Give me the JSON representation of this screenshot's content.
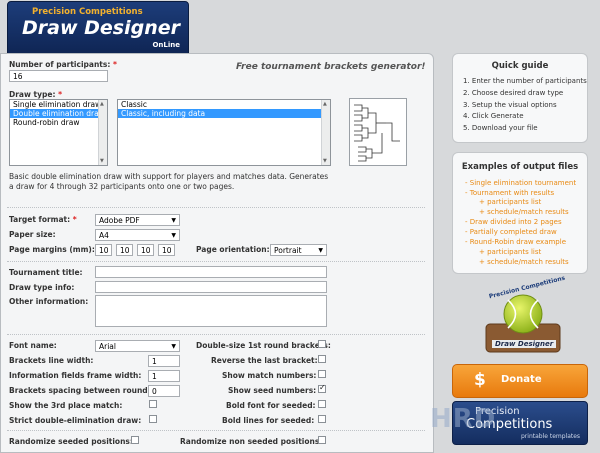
{
  "logo": {
    "line1": "Precision Competitions",
    "line2": "Draw Designer",
    "line3": "OnLine"
  },
  "tagline": "Free tournament brackets generator!",
  "form": {
    "participants_label": "Number of participants:",
    "participants_value": "16",
    "draw_type_label": "Draw type:",
    "draw_types": [
      "Single elimination draw",
      "Double elimination draw",
      "Round-robin draw"
    ],
    "draw_type_selected_index": 1,
    "draw_styles": [
      "Classic",
      "Classic, including data"
    ],
    "draw_style_selected_index": 1,
    "description": "Basic double elimination draw with support for players and matches data. Generates a draw for 4 through 32 participants onto one or two pages.",
    "target_format_label": "Target format:",
    "target_format_value": "Adobe PDF",
    "paper_size_label": "Paper size:",
    "paper_size_value": "A4",
    "margins_label": "Page margins (mm):",
    "margins": [
      "10",
      "10",
      "10",
      "10"
    ],
    "orientation_label": "Page orientation:",
    "orientation_value": "Portrait",
    "tournament_title_label": "Tournament title:",
    "draw_type_info_label": "Draw type info:",
    "other_info_label": "Other information:",
    "font_name_label": "Font name:",
    "font_name_value": "Arial",
    "bracket_line_width_label": "Brackets line width:",
    "bracket_line_width_value": "1",
    "info_frame_width_label": "Information fields frame width:",
    "info_frame_width_value": "1",
    "bracket_spacing_label": "Brackets spacing between rounds:",
    "bracket_spacing_value": "0",
    "show_3rd_place_label": "Show the 3rd place match:",
    "strict_double_label": "Strict double-elimination draw:",
    "double_size_label": "Double-size 1st round brackets:",
    "reverse_last_label": "Reverse the last bracket:",
    "show_match_numbers_label": "Show match numbers:",
    "show_seed_numbers_label": "Show seed numbers:",
    "bold_seeded_label": "Bold font for seeded:",
    "bold_lines_label": "Bold lines for seeded:",
    "randomize_seeded_label": "Randomize seeded positions:",
    "randomize_nonseeded_label": "Randomize non seeded positions:"
  },
  "checkboxes": {
    "show_3rd_place": false,
    "strict_double": false,
    "double_size": false,
    "reverse_last": false,
    "show_match_numbers": false,
    "show_seed_numbers": true,
    "bold_seeded": false,
    "bold_lines": false,
    "randomize_seeded": false,
    "randomize_nonseeded": false
  },
  "quick_guide": {
    "title": "Quick guide",
    "steps": [
      "1. Enter the number of participants",
      "2. Choose desired draw type",
      "3. Setup the visual options",
      "4. Click Generate",
      "5. Download your file"
    ]
  },
  "examples": {
    "title": "Examples of output files",
    "items": [
      "- Single elimination tournament",
      "- Tournament with results",
      "+ participants list",
      "+ schedule/match results",
      "- Draw divided into 2 pages",
      "- Partially completed draw",
      "- Round-Robin draw example",
      "+ participants list",
      "+ schedule/match results"
    ]
  },
  "badge": {
    "top_text": "Precision Competitions",
    "bottom_text": "Draw Designer"
  },
  "donate": {
    "symbol": "$",
    "label": "Donate"
  },
  "banner": {
    "line1": "Precision",
    "line2": "Competitions",
    "line3": "printable templates"
  },
  "watermark": "HRD",
  "colors": {
    "accent_orange": "#e88a14",
    "selection_blue": "#3399ff",
    "logo_navy": "#1d3d7a"
  }
}
